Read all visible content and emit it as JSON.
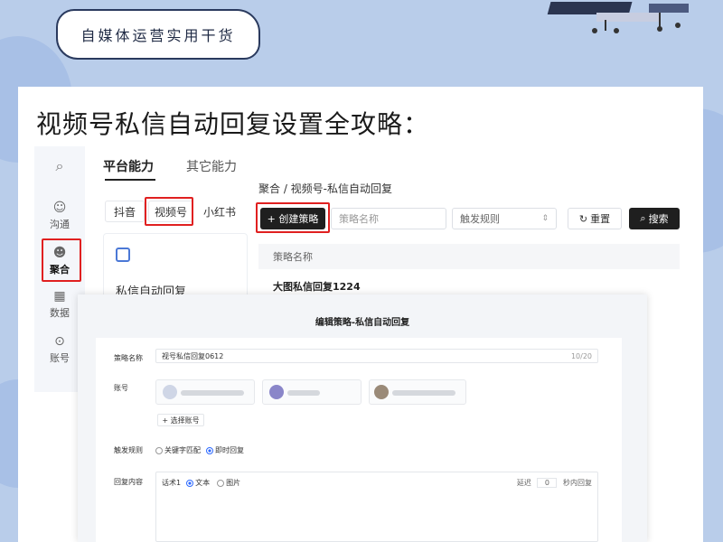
{
  "banner": {
    "tag": "自媒体运营实用干货"
  },
  "headline": "视频号私信自动回复设置全攻略：",
  "sidebar": {
    "items": [
      {
        "label": "沟通",
        "icon": "chat-icon"
      },
      {
        "label": "聚合",
        "icon": "aggregate-icon"
      },
      {
        "label": "数据",
        "icon": "chart-icon"
      },
      {
        "label": "账号",
        "icon": "account-icon"
      }
    ],
    "search_icon": "search-icon"
  },
  "tabs": {
    "main": "平台能力",
    "other": "其它能力"
  },
  "platforms": [
    "抖音",
    "视频号",
    "小红书"
  ],
  "panel": {
    "label": "私信自动回复"
  },
  "breadcrumb": "聚合 / 视频号-私信自动回复",
  "toolbar": {
    "create": "+ 创建策略",
    "name_placeholder": "策略名称",
    "trigger_placeholder": "触发规则",
    "reset": "重置",
    "search": "搜索"
  },
  "table": {
    "header": "策略名称",
    "rows": [
      "大图私信回复1224"
    ]
  },
  "editor": {
    "title": "编辑策略-私信自动回复",
    "name_label": "策略名称",
    "name_value": "视号私信回复0612",
    "name_count": "10/20",
    "account_label": "账号",
    "add_account": "+ 选择账号",
    "trigger_label": "触发规则",
    "trigger_opt1": "关键字匹配",
    "trigger_opt2": "即时回复",
    "reply_label": "回复内容",
    "reply_prefix": "话术1",
    "reply_opt1": "文本",
    "reply_opt2": "图片",
    "delay_label": "延迟",
    "delay_value": "0",
    "delay_unit": "秒内回复"
  },
  "colors": {
    "accent": "#e02020",
    "dark": "#1f1f1f",
    "bg": "#b9cdea"
  }
}
